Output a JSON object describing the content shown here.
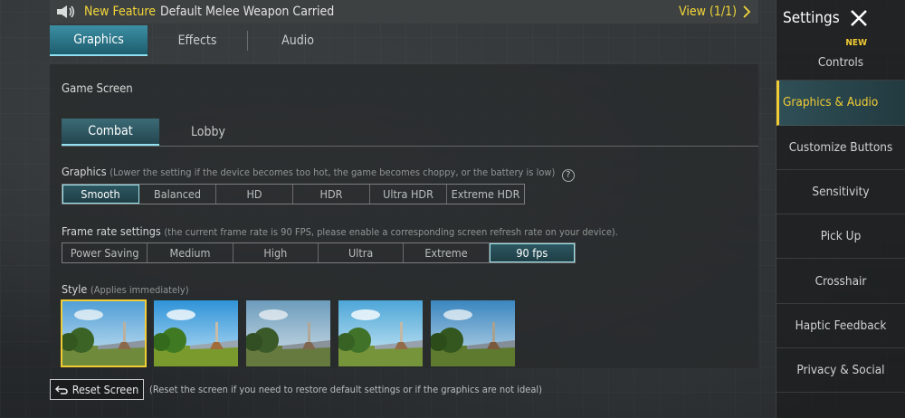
{
  "announcement": {
    "badge": "New Feature",
    "message": "Default Melee Weapon Carried",
    "view_label": "View (1/1)"
  },
  "tabs": [
    {
      "label": "Graphics",
      "active": true
    },
    {
      "label": "Effects",
      "active": false
    },
    {
      "label": "Audio",
      "active": false
    }
  ],
  "game_screen": {
    "title": "Game Screen",
    "subtabs": [
      {
        "label": "Combat",
        "active": true
      },
      {
        "label": "Lobby",
        "active": false
      }
    ]
  },
  "graphics": {
    "label": "Graphics",
    "hint": "(Lower the setting if the device becomes too hot, the game becomes choppy, or the battery is low)",
    "help_glyph": "?",
    "options": [
      "Smooth",
      "Balanced",
      "HD",
      "HDR",
      "Ultra HDR",
      "Extreme HDR"
    ],
    "selected": "Smooth"
  },
  "frame_rate": {
    "label": "Frame rate settings",
    "hint": "(the current frame rate is 90 FPS, please enable a corresponding screen refresh rate on your device).",
    "options": [
      "Power Saving",
      "Medium",
      "High",
      "Ultra",
      "Extreme",
      "90 fps"
    ],
    "selected": "90 fps"
  },
  "style": {
    "label": "Style",
    "hint": "(Applies immediately)",
    "thumbnails": [
      {
        "name": "style-1",
        "active": true
      },
      {
        "name": "style-2",
        "active": false
      },
      {
        "name": "style-3",
        "active": false
      },
      {
        "name": "style-4",
        "active": false
      },
      {
        "name": "style-5",
        "active": false
      }
    ]
  },
  "reset": {
    "button_label": "Reset Screen",
    "note": "(Reset the screen if you need to restore default settings or if the graphics are not ideal)"
  },
  "sidebar": {
    "title": "Settings",
    "items": [
      {
        "label": "Controls",
        "badge": "NEW",
        "active": false
      },
      {
        "label": "Graphics & Audio",
        "active": true
      },
      {
        "label": "Customize Buttons",
        "active": false
      },
      {
        "label": "Sensitivity",
        "active": false
      },
      {
        "label": "Pick Up",
        "active": false
      },
      {
        "label": "Crosshair",
        "active": false
      },
      {
        "label": "Haptic Feedback",
        "active": false
      },
      {
        "label": "Privacy & Social",
        "active": false
      }
    ]
  },
  "colors": {
    "accent_yellow": "#f2cc34",
    "accent_teal": "#3c8fa4",
    "highlight_cyan": "#8fe0f0"
  }
}
